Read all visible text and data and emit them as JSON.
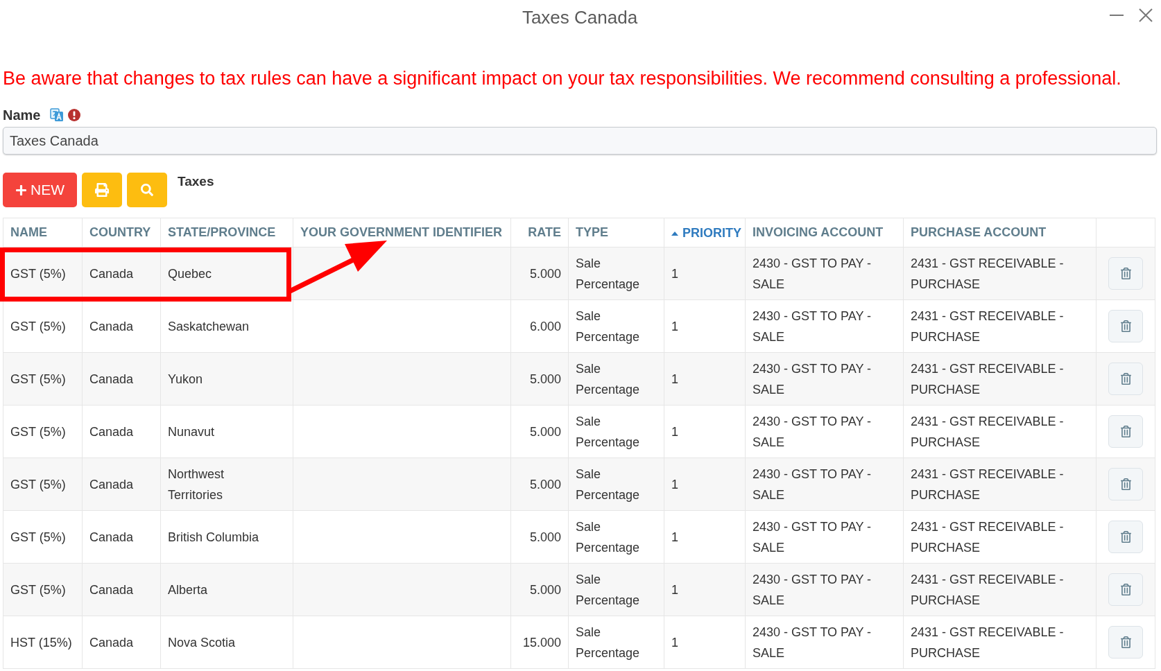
{
  "window": {
    "title": "Taxes Canada"
  },
  "warning": "Be aware that changes to tax rules can have a significant impact on your tax responsibilities. We recommend consulting a professional.",
  "name_field": {
    "label": "Name",
    "value": "Taxes Canada"
  },
  "toolbar": {
    "buttons": [
      {
        "kind": "new",
        "label": "NEW"
      },
      {
        "kind": "print"
      },
      {
        "kind": "search"
      }
    ],
    "title": "Taxes"
  },
  "table": {
    "columns": [
      {
        "label": "NAME",
        "sorted": false
      },
      {
        "label": "COUNTRY",
        "sorted": false
      },
      {
        "label": "STATE/PROVINCE",
        "sorted": false
      },
      {
        "label": "YOUR GOVERNMENT IDENTIFIER",
        "sorted": false
      },
      {
        "label": "RATE",
        "sorted": false
      },
      {
        "label": "TYPE",
        "sorted": false
      },
      {
        "label": "PRIORITY",
        "sorted": true
      },
      {
        "label": "INVOICING ACCOUNT",
        "sorted": false
      },
      {
        "label": "PURCHASE ACCOUNT",
        "sorted": false
      }
    ],
    "rows": [
      {
        "name": "GST (5%)",
        "country": "Canada",
        "state_province": "Quebec",
        "rate": "5.000",
        "type": "Sale Percentage",
        "priority": "1",
        "invoicing_account": "2430 - GST TO PAY - SALE",
        "purchase_account": "2431 - GST RECEIVABLE - PURCHASE"
      },
      {
        "name": "GST (5%)",
        "country": "Canada",
        "state_province": "Saskatchewan",
        "rate": "6.000",
        "type": "Sale Percentage",
        "priority": "1",
        "invoicing_account": "2430 - GST TO PAY - SALE",
        "purchase_account": "2431 - GST RECEIVABLE - PURCHASE"
      },
      {
        "name": "GST (5%)",
        "country": "Canada",
        "state_province": "Yukon",
        "rate": "5.000",
        "type": "Sale Percentage",
        "priority": "1",
        "invoicing_account": "2430 - GST TO PAY - SALE",
        "purchase_account": "2431 - GST RECEIVABLE - PURCHASE"
      },
      {
        "name": "GST (5%)",
        "country": "Canada",
        "state_province": "Nunavut",
        "rate": "5.000",
        "type": "Sale Percentage",
        "priority": "1",
        "invoicing_account": "2430 - GST TO PAY - SALE",
        "purchase_account": "2431 - GST RECEIVABLE - PURCHASE"
      },
      {
        "name": "GST (5%)",
        "country": "Canada",
        "state_province": "Northwest Territories",
        "rate": "5.000",
        "type": "Sale Percentage",
        "priority": "1",
        "invoicing_account": "2430 - GST TO PAY - SALE",
        "purchase_account": "2431 - GST RECEIVABLE - PURCHASE"
      },
      {
        "name": "GST (5%)",
        "country": "Canada",
        "state_province": "British Columbia",
        "rate": "5.000",
        "type": "Sale Percentage",
        "priority": "1",
        "invoicing_account": "2430 - GST TO PAY - SALE",
        "purchase_account": "2431 - GST RECEIVABLE - PURCHASE"
      },
      {
        "name": "GST (5%)",
        "country": "Canada",
        "state_province": "Alberta",
        "rate": "5.000",
        "type": "Sale Percentage",
        "priority": "1",
        "invoicing_account": "2430 - GST TO PAY - SALE",
        "purchase_account": "2431 - GST RECEIVABLE - PURCHASE"
      },
      {
        "name": "HST (15%)",
        "country": "Canada",
        "state_province": "Nova Scotia",
        "rate": "15.000",
        "type": "Sale Percentage",
        "priority": "1",
        "invoicing_account": "2430 - GST TO PAY - SALE",
        "purchase_account": "2431 - GST RECEIVABLE - PURCHASE"
      }
    ]
  }
}
